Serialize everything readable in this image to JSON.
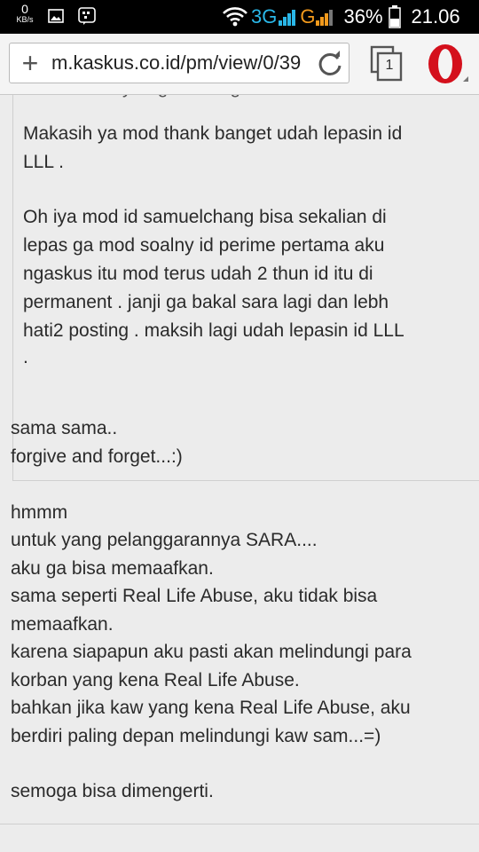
{
  "status_bar": {
    "speed_value": "0",
    "speed_unit": "KB/s",
    "network_3g": "3G",
    "network_g": "G",
    "battery_percent": "36%",
    "time": "21.06"
  },
  "browser": {
    "new_tab_label": "+",
    "url": "m.kaskus.co.id/pm/view/0/39",
    "tab_count": "1",
    "logo_letter": "O"
  },
  "quote": {
    "cut_line": "…sebelumnya agan dan gan…",
    "para1_line1": "Makasih ya mod thank banget udah lepasin id",
    "para1_line2": "LLL .",
    "para2_line1": "Oh iya mod id samuelchang bisa sekalian di",
    "para2_line2": "lepas ga mod soalny id perime pertama aku",
    "para2_line3": "ngaskus itu mod terus udah 2 thun id itu di",
    "para2_line4": "permanent . janji ga bakal sara lagi dan lebh",
    "para2_line5": "hati2 posting . maksih lagi udah lepasin id LLL",
    "para2_line6": "."
  },
  "reply": {
    "lines": [
      "sama sama..",
      "forgive and forget...:)",
      "",
      "hmmm",
      "untuk yang pelanggarannya SARA....",
      "aku ga bisa memaafkan.",
      "sama seperti Real Life Abuse, aku tidak bisa",
      "memaafkan.",
      "karena siapapun aku pasti akan melindungi para",
      "korban yang kena Real Life Abuse.",
      "bahkan jika kaw yang kena Real Life Abuse, aku",
      "berdiri paling depan melindungi kaw sam...=)",
      "",
      "semoga bisa dimengerti."
    ]
  },
  "colors": {
    "status_bar_bg": "#000000",
    "network_accent": "#2ab7e8",
    "opera_red": "#d4101c",
    "page_bg": "#ececec"
  }
}
